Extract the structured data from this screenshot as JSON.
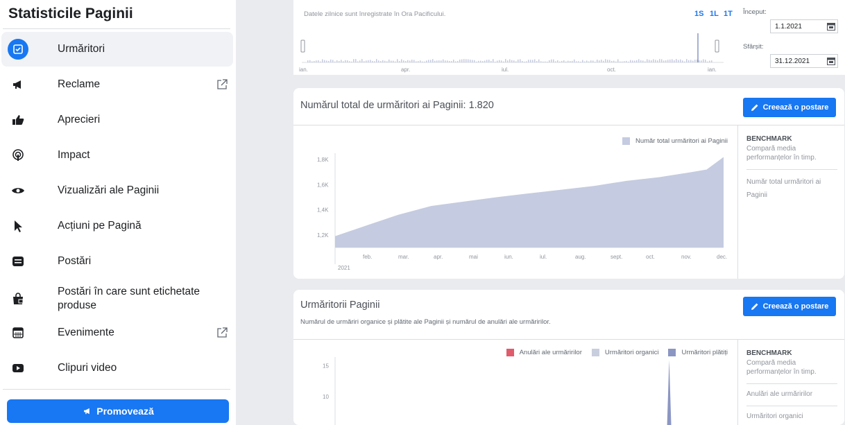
{
  "sidebar": {
    "title": "Statisticile Paginii",
    "items": [
      {
        "label": "Urmăritori",
        "icon": "followers-icon",
        "active": true
      },
      {
        "label": "Reclame",
        "icon": "megaphone-icon",
        "external": true
      },
      {
        "label": "Aprecieri",
        "icon": "thumbs-up-icon"
      },
      {
        "label": "Impact",
        "icon": "reach-icon"
      },
      {
        "label": "Vizualizări ale Paginii",
        "icon": "eye-icon"
      },
      {
        "label": "Acțiuni pe Pagină",
        "icon": "cursor-icon"
      },
      {
        "label": "Postări",
        "icon": "posts-icon"
      },
      {
        "label": "Postări în care sunt etichetate produse",
        "icon": "shopping-bag-icon"
      },
      {
        "label": "Evenimente",
        "icon": "calendar-icon",
        "external": true
      },
      {
        "label": "Clipuri video",
        "icon": "video-icon"
      }
    ],
    "promote_label": "Promovează"
  },
  "range": {
    "note": "Datele zilnice sunt înregistrate în Ora Pacificului.",
    "periods": [
      "1S",
      "1L",
      "1T"
    ],
    "months": [
      "ian.",
      "apr.",
      "iul.",
      "oct.",
      "ian."
    ],
    "start_label": "Început:",
    "start_value": "1.1.2021",
    "end_label": "Sfârșit:",
    "end_value": "31.12.2021"
  },
  "total_card": {
    "title": "Numărul total de urmăritori ai Paginii: 1.820",
    "create_label": "Creează o postare",
    "legend": "Număr total urmăritori ai Paginii",
    "benchmark_title": "BENCHMARK",
    "benchmark_desc": "Compară media performanțelor în timp.",
    "benchmark_item": "Număr total urmăritori ai Paginii"
  },
  "followers_card": {
    "title": "Urmăritorii Paginii",
    "subtitle": "Numărul de urmăriri organice și plătite ale Paginii și numărul de anulări ale urmăririlor.",
    "create_label": "Creează o postare",
    "legend": [
      "Anulări ale urmăririlor",
      "Urmăritori organici",
      "Urmăritori plătiți"
    ],
    "benchmark_title": "BENCHMARK",
    "benchmark_desc": "Compară media performanțelor în timp.",
    "benchmark_items": [
      "Anulări ale urmăririlor",
      "Urmăritori organici"
    ]
  },
  "colors": {
    "accent": "#1877f2",
    "area": "#c5cbe0",
    "unfollow": "#e05b6c",
    "organic": "#c9cede",
    "paid": "#8b96c3"
  },
  "chart_data": [
    {
      "type": "area",
      "title": "",
      "xlabel": "",
      "ylabel": "",
      "categories": [
        "feb.",
        "mar.",
        "apr.",
        "mai",
        "iun.",
        "iul.",
        "aug.",
        "sept.",
        "oct.",
        "nov.",
        "dec."
      ],
      "year_label": "2021",
      "yticks": [
        "1,2K",
        "1,4K",
        "1,6K",
        "1,8K"
      ],
      "ylim": [
        1100,
        1850
      ],
      "series": [
        {
          "name": "Număr total urmăritori ai Paginii",
          "x": [
            "2021-01-01",
            "2021-02-01",
            "2021-03-01",
            "2021-04-01",
            "2021-05-01",
            "2021-06-01",
            "2021-07-01",
            "2021-08-01",
            "2021-09-01",
            "2021-10-01",
            "2021-11-01",
            "2021-12-01",
            "2021-12-15",
            "2021-12-31"
          ],
          "values": [
            1190,
            1280,
            1360,
            1430,
            1465,
            1500,
            1530,
            1560,
            1590,
            1630,
            1660,
            1700,
            1720,
            1820
          ]
        }
      ]
    },
    {
      "type": "area",
      "title": "",
      "yticks": [
        "10",
        "15"
      ],
      "ylim": [
        0,
        17
      ],
      "series": [
        {
          "name": "Anulări ale urmăririlor",
          "values": []
        },
        {
          "name": "Urmăritori organici",
          "values": []
        },
        {
          "name": "Urmăritori plătiți",
          "x": [
            "2021-11-10"
          ],
          "values": [
            16
          ]
        }
      ]
    }
  ]
}
